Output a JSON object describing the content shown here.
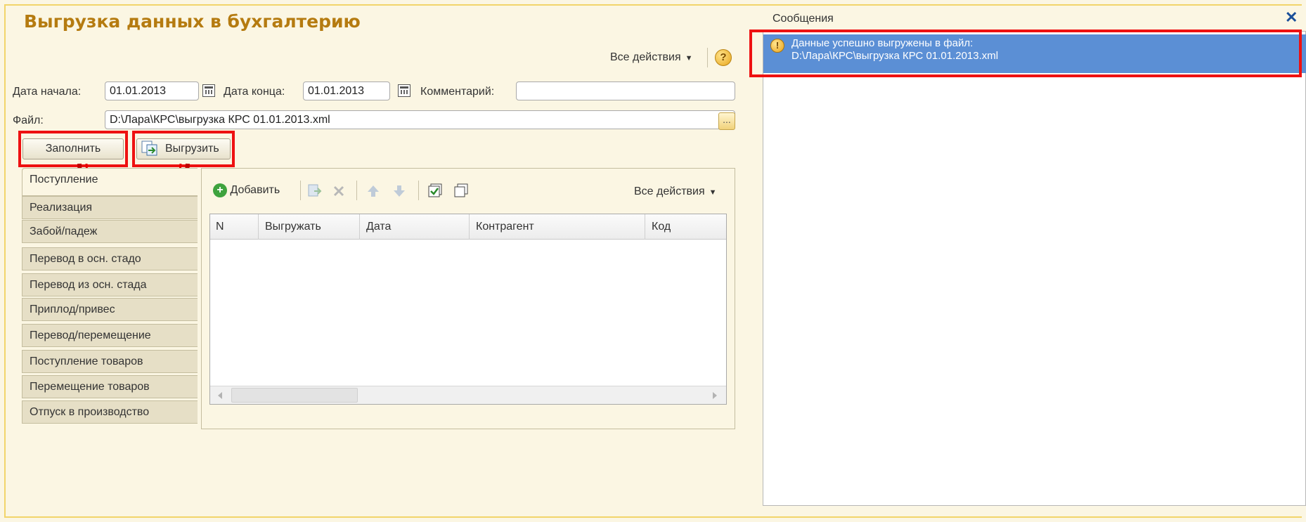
{
  "form": {
    "title": "Выгрузка данных в бухгалтерию",
    "all_actions": "Все действия",
    "help_glyph": "?",
    "date_start_label": "Дата начала:",
    "date_start_value": "01.01.2013",
    "date_end_label": "Дата конца:",
    "date_end_value": "01.01.2013",
    "comment_label": "Комментарий:",
    "comment_value": "",
    "file_label": "Файл:",
    "file_value": "D:\\Лара\\КРС\\выгрузка КРС 01.01.2013.xml",
    "file_button": "...",
    "fill_button": "Заполнить",
    "export_button": "Выгрузить"
  },
  "tabs": [
    {
      "label": "Поступление",
      "active": true
    },
    {
      "label": "Реализация"
    },
    {
      "label": "Забой/падеж"
    },
    {
      "label": "Перевод в осн. стадо"
    },
    {
      "label": "Перевод из осн. стада"
    },
    {
      "label": "Приплод/привес"
    },
    {
      "label": "Перевод/перемещение"
    },
    {
      "label": "Поступление товаров"
    },
    {
      "label": "Перемещение товаров"
    },
    {
      "label": "Отпуск в производство"
    }
  ],
  "table_toolbar": {
    "add": "Добавить",
    "all_actions": "Все действия"
  },
  "table": {
    "columns": [
      "N",
      "Выгружать",
      "Дата",
      "Контрагент",
      "Код"
    ],
    "rows": []
  },
  "messages": {
    "title": "Сообщения",
    "close_glyph": "✕",
    "items": [
      {
        "line1": "Данные успешно выгружены в файл:",
        "line2": "D:\\Лара\\КРС\\выгрузка КРС 01.01.2013.xml"
      }
    ]
  },
  "colors": {
    "title": "#b57b10",
    "highlight": "#ee1111",
    "selection": "#5b8fd5"
  }
}
